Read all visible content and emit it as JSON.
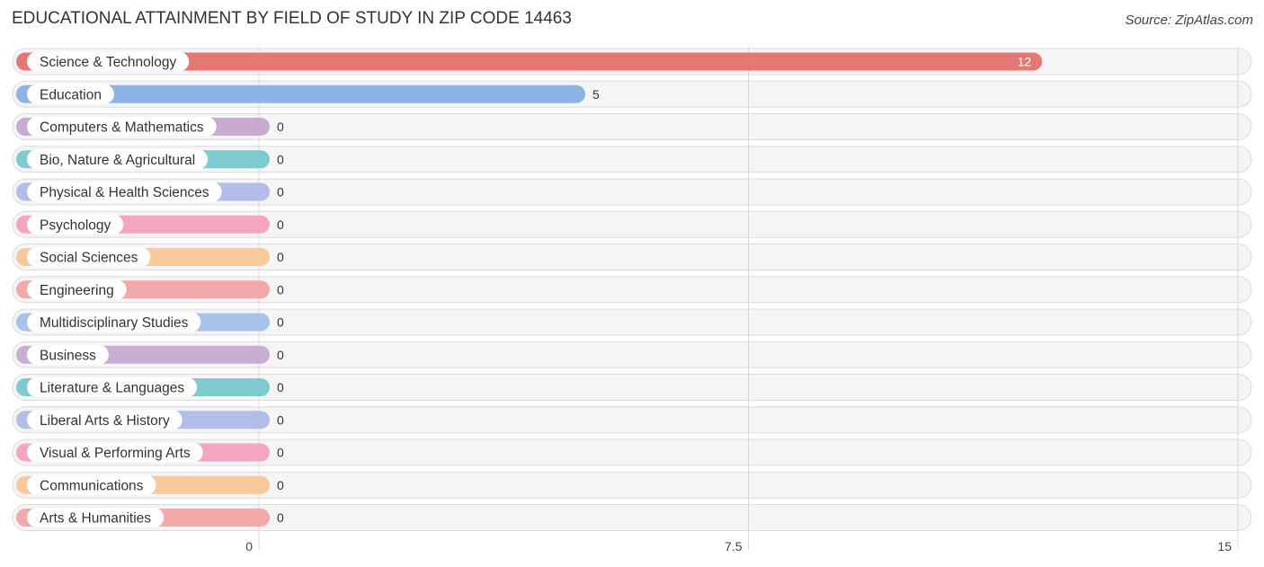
{
  "header": {
    "title": "EDUCATIONAL ATTAINMENT BY FIELD OF STUDY IN ZIP CODE 14463",
    "source": "Source: ZipAtlas.com"
  },
  "chart_data": {
    "type": "bar",
    "orientation": "horizontal",
    "title": "EDUCATIONAL ATTAINMENT BY FIELD OF STUDY IN ZIP CODE 14463",
    "xlabel": "",
    "ylabel": "",
    "xlim": [
      0,
      15
    ],
    "xticks": [
      0,
      7.5,
      15
    ],
    "xtick_labels": [
      "0",
      "7.5",
      "15"
    ],
    "grid": true,
    "categories": [
      "Science & Technology",
      "Education",
      "Computers & Mathematics",
      "Bio, Nature & Agricultural",
      "Physical & Health Sciences",
      "Psychology",
      "Social Sciences",
      "Engineering",
      "Multidisciplinary Studies",
      "Business",
      "Literature & Languages",
      "Liberal Arts & History",
      "Visual & Performing Arts",
      "Communications",
      "Arts & Humanities"
    ],
    "values": [
      12,
      5,
      0,
      0,
      0,
      0,
      0,
      0,
      0,
      0,
      0,
      0,
      0,
      0,
      0
    ],
    "value_labels": [
      "12",
      "5",
      "0",
      "0",
      "0",
      "0",
      "0",
      "0",
      "0",
      "0",
      "0",
      "0",
      "0",
      "0",
      "0"
    ],
    "colors": [
      "#e57873",
      "#8db4e5",
      "#c9abd1",
      "#7ecbcf",
      "#b3bde9",
      "#f5a5c0",
      "#f9c99c",
      "#f1aaa9",
      "#a7c3e9",
      "#c8aed3",
      "#7ecbcf",
      "#b3bde9",
      "#f5a5c0",
      "#f9c99c",
      "#f1aaa9"
    ]
  }
}
